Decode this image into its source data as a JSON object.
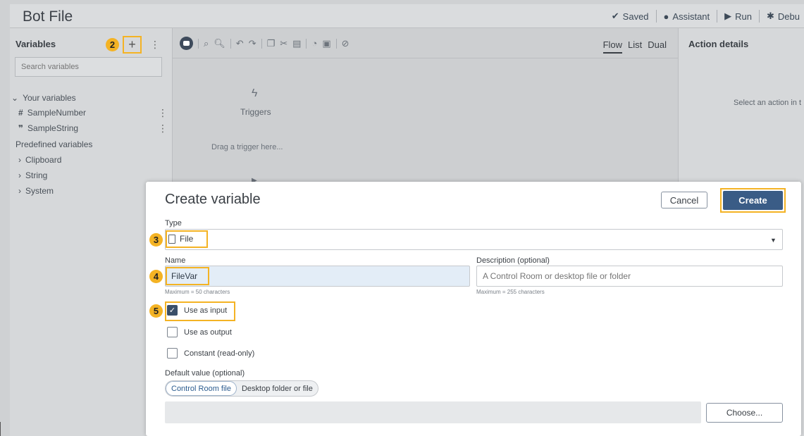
{
  "app": {
    "title": "Bot File",
    "status": {
      "saved": "Saved",
      "assistant": "Assistant",
      "run": "Run",
      "debug": "Debu"
    }
  },
  "sidebar": {
    "header": "Variables",
    "search_placeholder": "Search variables",
    "your_variables_label": "Your variables",
    "variables": [
      {
        "label": "SampleNumber",
        "icon": "hash-icon"
      },
      {
        "label": "SampleString",
        "icon": "quote-icon"
      }
    ],
    "predefined_label": "Predefined variables",
    "predefined": [
      {
        "label": "Clipboard"
      },
      {
        "label": "String"
      },
      {
        "label": "System"
      }
    ]
  },
  "canvas": {
    "views": [
      "Flow",
      "List",
      "Dual"
    ],
    "active_view": "Flow",
    "triggers_label": "Triggers",
    "drag_hint": "Drag a trigger here..."
  },
  "details": {
    "title": "Action details",
    "hint": "Select an action in t"
  },
  "dialog": {
    "title": "Create variable",
    "cancel": "Cancel",
    "create": "Create",
    "type_label": "Type",
    "type_value": "File",
    "name_label": "Name",
    "name_value": "FileVar",
    "name_hint": "Maximum = 50 characters",
    "desc_label": "Description (optional)",
    "desc_placeholder": "A Control Room or desktop file or folder",
    "desc_hint": "Maximum = 255 characters",
    "options": [
      {
        "label": "Use as input",
        "checked": true
      },
      {
        "label": "Use as output",
        "checked": false
      },
      {
        "label": "Constant (read-only)",
        "checked": false
      }
    ],
    "default_label": "Default value (optional)",
    "default_tabs": [
      "Control Room file",
      "Desktop folder or file"
    ],
    "default_active": "Control Room file",
    "choose": "Choose..."
  },
  "callouts": [
    "2",
    "3",
    "4",
    "5"
  ],
  "colors": {
    "callout": "#f4b324",
    "primary": "#3a5c86",
    "overlay": "#cfd1d3"
  }
}
